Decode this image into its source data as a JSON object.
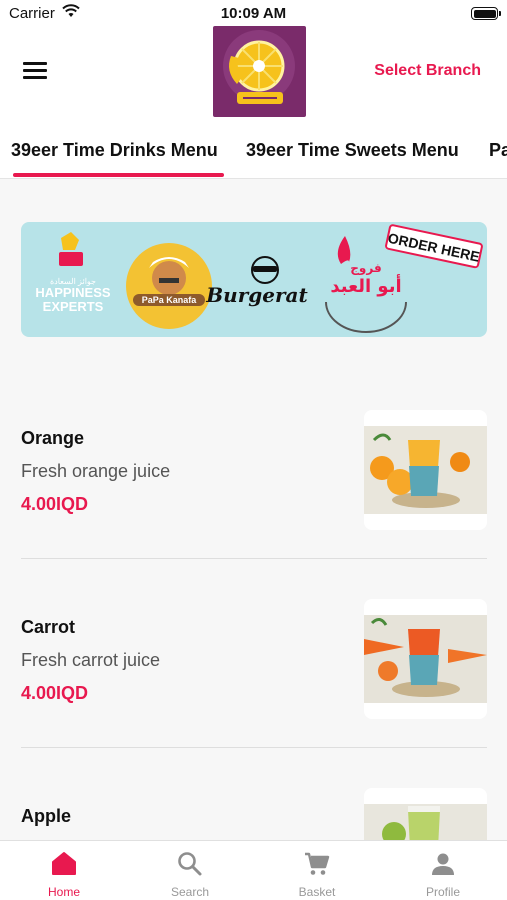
{
  "status_bar": {
    "carrier": "Carrier",
    "time": "10:09 AM"
  },
  "header": {
    "select_branch": "Select Branch",
    "logo": "restaurant-logo"
  },
  "tabs": [
    {
      "label": "39eer Time Drinks Menu",
      "active": true
    },
    {
      "label": "39eer Time Sweets Menu",
      "active": false
    },
    {
      "label": "Pa",
      "active": false
    }
  ],
  "banner": {
    "order_here": "ORDER HERE",
    "happiness_line1": "HAPPINESS",
    "happiness_line2": "EXPERTS",
    "papa_kanafa": "PaPa Kanafa",
    "burgerat": "Burgerat",
    "abu_alabd": "أبو العبد",
    "frooj": "فروج"
  },
  "items": [
    {
      "name": "Orange",
      "description": "Fresh orange juice",
      "price": "4.00IQD",
      "drink_color": "#f6a21c"
    },
    {
      "name": "Carrot",
      "description": "Fresh carrot juice",
      "price": "4.00IQD",
      "drink_color": "#ef6a23"
    },
    {
      "name": "Apple",
      "description": "",
      "price": "",
      "drink_color": "#9ec24a"
    }
  ],
  "tabbar": [
    {
      "label": "Home",
      "icon": "home-icon",
      "active": true
    },
    {
      "label": "Search",
      "icon": "search-icon",
      "active": false
    },
    {
      "label": "Basket",
      "icon": "cart-icon",
      "active": false
    },
    {
      "label": "Profile",
      "icon": "person-icon",
      "active": false
    }
  ],
  "colors": {
    "accent": "#e8194f",
    "banner_bg": "#b7e3e8",
    "logo_bg": "#7a2b6a"
  }
}
